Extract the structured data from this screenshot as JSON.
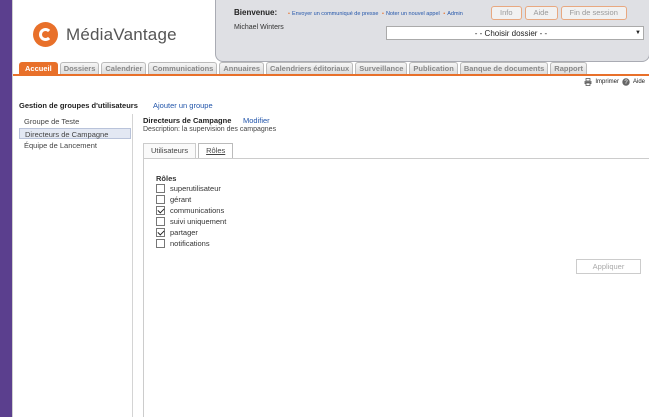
{
  "brand": {
    "name": "MédiaVantage",
    "accent": "#e8702a",
    "frame_bg": "#5b3f8e"
  },
  "user_panel": {
    "welcome": "Bienvenue:",
    "username": "Michael Winters",
    "quick_links": [
      "Envoyer un communiqué de presse",
      "Noter un nouvel appel",
      "Admin"
    ],
    "buttons": [
      "Info",
      "Aide",
      "Fin de session"
    ],
    "dossier_select": "- - Choisir dossier - -"
  },
  "nav": {
    "tabs": [
      "Accueil",
      "Dossiers",
      "Calendrier",
      "Communications",
      "Annuaires",
      "Calendriers éditoriaux",
      "Surveillance",
      "Publication",
      "Banque de documents",
      "Rapport"
    ],
    "active": "Accueil"
  },
  "tools": {
    "print": "Imprimer",
    "help": "Aide"
  },
  "left": {
    "title": "Gestion de groupes d'utilisateurs",
    "add": "Ajouter un groupe",
    "groups": [
      "Groupe de Teste",
      "Directeurs de Campagne",
      "Équipe de Lancement"
    ],
    "selected_index": 1
  },
  "group": {
    "name": "Directeurs de Campagne",
    "modify": "Modifier",
    "description": "Description: la supervision des campagnes"
  },
  "tabs": [
    "Utilisateurs",
    "Rôles"
  ],
  "roles": {
    "heading": "Rôles",
    "items": [
      {
        "label": "superutilisateur",
        "checked": false
      },
      {
        "label": "gérant",
        "checked": false
      },
      {
        "label": "communications",
        "checked": true
      },
      {
        "label": "suivi uniquement",
        "checked": false
      },
      {
        "label": "partager",
        "checked": true
      },
      {
        "label": "notifications",
        "checked": false
      }
    ],
    "apply": "Appliquer"
  }
}
